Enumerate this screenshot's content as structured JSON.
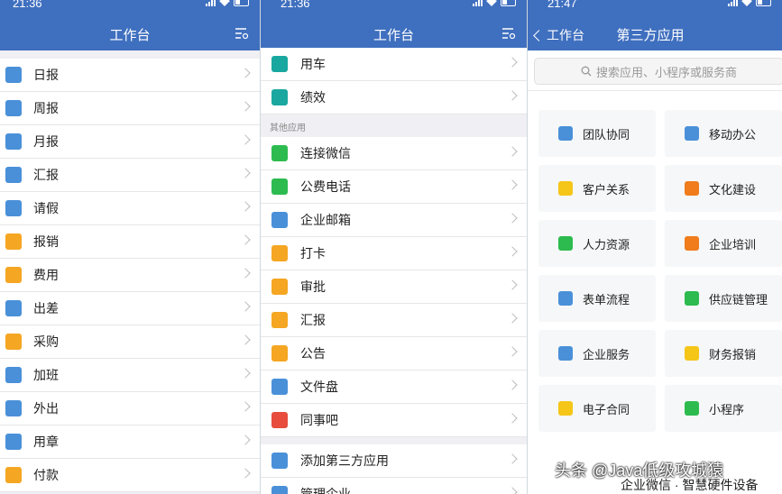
{
  "panel1": {
    "status_time": "21:36",
    "title": "工作台",
    "items": [
      {
        "label": "日报",
        "icon": "daily-report-icon",
        "color": "#4a90d9"
      },
      {
        "label": "周报",
        "icon": "weekly-report-icon",
        "color": "#4a90d9"
      },
      {
        "label": "月报",
        "icon": "monthly-report-icon",
        "color": "#4a90d9"
      },
      {
        "label": "汇报",
        "icon": "report-icon",
        "color": "#4a90d9"
      },
      {
        "label": "请假",
        "icon": "calendar-icon",
        "color": "#4a90d9"
      },
      {
        "label": "报销",
        "icon": "reimburse-icon",
        "color": "#f5a623"
      },
      {
        "label": "费用",
        "icon": "wallet-icon",
        "color": "#f5a623"
      },
      {
        "label": "出差",
        "icon": "plane-icon",
        "color": "#4a90d9"
      },
      {
        "label": "采购",
        "icon": "cart-icon",
        "color": "#f5a623"
      },
      {
        "label": "加班",
        "icon": "overtime-icon",
        "color": "#4a90d9"
      },
      {
        "label": "外出",
        "icon": "briefcase-icon",
        "color": "#4a90d9"
      },
      {
        "label": "用章",
        "icon": "seal-icon",
        "color": "#4a90d9"
      },
      {
        "label": "付款",
        "icon": "payment-icon",
        "color": "#f5a623"
      }
    ]
  },
  "panel2": {
    "status_time": "21:36",
    "title": "工作台",
    "top_items": [
      {
        "label": "用车",
        "icon": "car-icon",
        "color": "#1aa7a0"
      },
      {
        "label": "绩效",
        "icon": "bar-chart-icon",
        "color": "#1aa7a0"
      }
    ],
    "section_label": "其他应用",
    "items": [
      {
        "label": "连接微信",
        "icon": "wechat-icon",
        "color": "#2dbb4f"
      },
      {
        "label": "公费电话",
        "icon": "phone-icon",
        "color": "#2dbb4f"
      },
      {
        "label": "企业邮箱",
        "icon": "mail-icon",
        "color": "#4a90d9"
      },
      {
        "label": "打卡",
        "icon": "location-icon",
        "color": "#f5a623"
      },
      {
        "label": "审批",
        "icon": "stamp-icon",
        "color": "#f5a623"
      },
      {
        "label": "汇报",
        "icon": "document-icon",
        "color": "#f5a623"
      },
      {
        "label": "公告",
        "icon": "megaphone-icon",
        "color": "#f5a623"
      },
      {
        "label": "文件盘",
        "icon": "folder-icon",
        "color": "#4a90d9"
      },
      {
        "label": "同事吧",
        "icon": "colleagues-icon",
        "color": "#e74c3c"
      }
    ],
    "bottom_items": [
      {
        "label": "添加第三方应用",
        "icon": "compass-icon",
        "color": "#4a90d9"
      },
      {
        "label": "管理企业",
        "icon": "manage-icon",
        "color": "#4a90d9"
      }
    ]
  },
  "panel3": {
    "status_time": "21:47",
    "back_label": "工作台",
    "title": "第三方应用",
    "search_placeholder": "搜索应用、小程序或服务商",
    "tiles": [
      {
        "label": "团队协同",
        "icon": "team-icon",
        "color": "#4a90d9"
      },
      {
        "label": "移动办公",
        "icon": "mobile-icon",
        "color": "#4a90d9"
      },
      {
        "label": "客户关系",
        "icon": "handshake-icon",
        "color": "#f5c518"
      },
      {
        "label": "文化建设",
        "icon": "book-icon",
        "color": "#f07c1c"
      },
      {
        "label": "人力资源",
        "icon": "hr-icon",
        "color": "#2dbb4f"
      },
      {
        "label": "企业培训",
        "icon": "training-icon",
        "color": "#f07c1c"
      },
      {
        "label": "表单流程",
        "icon": "form-icon",
        "color": "#4a90d9"
      },
      {
        "label": "供应链管理",
        "icon": "truck-icon",
        "color": "#2dbb4f"
      },
      {
        "label": "企业服务",
        "icon": "home-icon",
        "color": "#4a90d9"
      },
      {
        "label": "财务报销",
        "icon": "coin-icon",
        "color": "#f5c518"
      },
      {
        "label": "电子合同",
        "icon": "contract-icon",
        "color": "#f5c518"
      },
      {
        "label": "小程序",
        "icon": "mini-program-icon",
        "color": "#2dbb4f"
      }
    ],
    "footer_text": "企业微信 · 智慧硬件设备"
  },
  "watermark": "头条 @Java低级攻城猿"
}
